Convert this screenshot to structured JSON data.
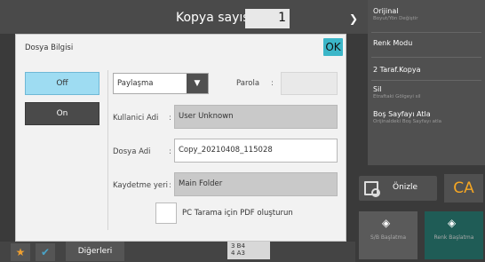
{
  "header": {
    "copy_count_label": "Kopya sayısı",
    "copy_count_value": "1"
  },
  "right_panel": {
    "items": [
      {
        "label": "Orijinal",
        "sub": "Boyut/Yön Değiştir"
      },
      {
        "label": "Renk Modu",
        "sub": ""
      },
      {
        "label": "2 Taraf.Kopya",
        "sub": ""
      },
      {
        "label": "Sil",
        "sub": "Etraftaki Gölgeyi sil"
      },
      {
        "label": "Boş Sayfayı Atla",
        "sub": "Orijinaldeki Boş Sayfayı atla"
      }
    ]
  },
  "actions": {
    "preview_label": "Önizle",
    "ca_label": "CA",
    "bw_start_label": "S/B Başlatma",
    "color_start_label": "Renk Başlatma"
  },
  "bottom": {
    "others_label": "Diğerleri",
    "paper_lines": [
      "3  B4",
      "4  A3"
    ]
  },
  "dialog": {
    "title": "Dosya Bilgisi",
    "ok_label": "OK",
    "off_label": "Off",
    "on_label": "On",
    "share_value": "Paylaşma",
    "password_label": "Parola",
    "username_label": "Kullanici Adi",
    "username_value": "User Unknown",
    "filename_label": "Dosya Adi",
    "filename_value": "Copy_20210408_115028",
    "save_location_label": "Kaydetme yeri",
    "save_location_value": "Main Folder",
    "pdf_checkbox_label": "PC Tarama için PDF oluşturun",
    "pdf_checked": false
  },
  "colors": {
    "ok_button": "#3bb6c8",
    "off_selected": "#9edcf2",
    "ca_text": "#f5a623",
    "color_start_bg": "#1f5c56"
  }
}
